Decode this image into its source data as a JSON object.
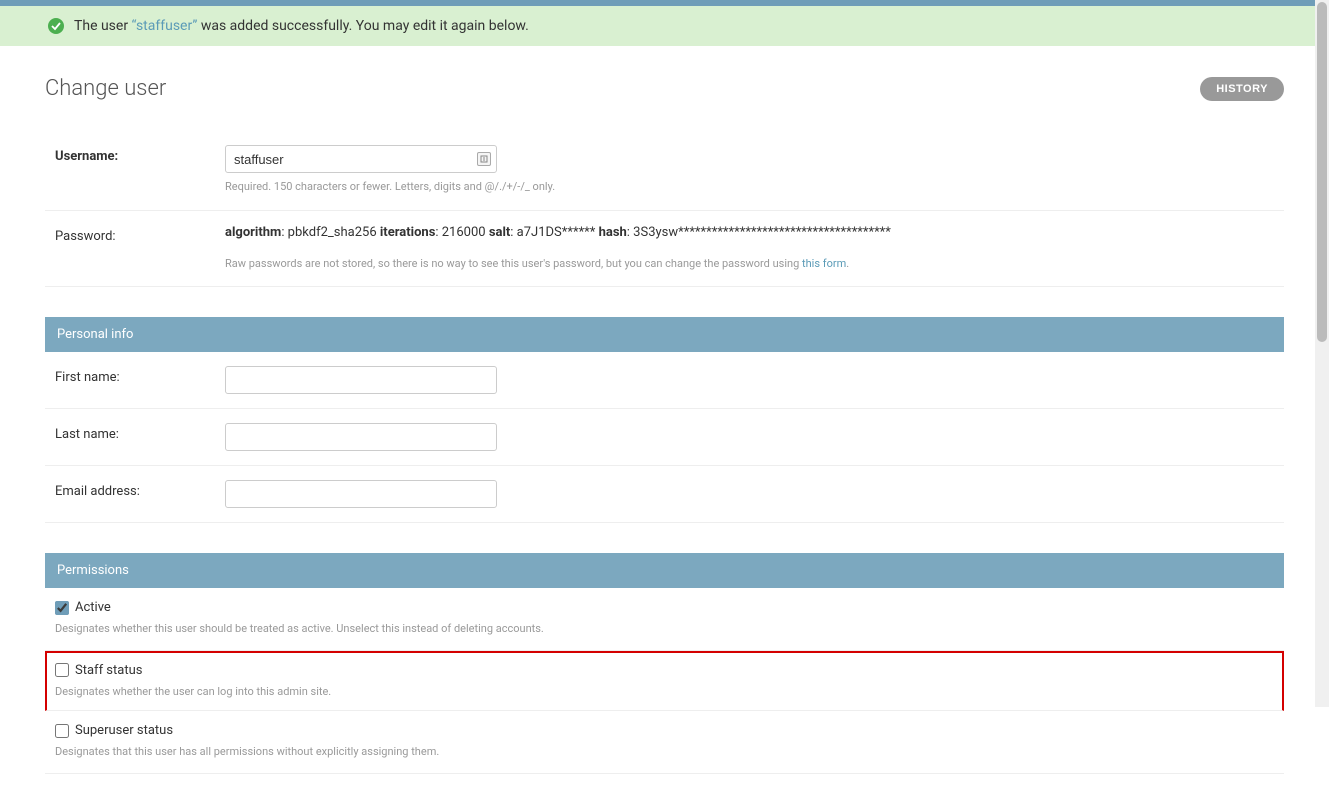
{
  "banner": {
    "prefix": "The user ",
    "quoted_open": "“",
    "user_link": "staffuser",
    "quoted_close": "”",
    "suffix": " was added successfully. You may edit it again below."
  },
  "page": {
    "title": "Change user",
    "history_button": "HISTORY"
  },
  "username": {
    "label": "Username:",
    "value": "staffuser",
    "help": "Required. 150 characters or fewer. Letters, digits and @/./+/-/_ only."
  },
  "password": {
    "label": "Password:",
    "algorithm_k": "algorithm",
    "algorithm_v": ": pbkdf2_sha256 ",
    "iterations_k": "iterations",
    "iterations_v": ": 216000 ",
    "salt_k": "salt",
    "salt_v": ": a7J1DS****** ",
    "hash_k": "hash",
    "hash_v": ": 3S3ysw**************************************",
    "help_prefix": "Raw passwords are not stored, so there is no way to see this user's password, but you can change the password using ",
    "help_link": "this form",
    "help_suffix": "."
  },
  "personal_info": {
    "header": "Personal info",
    "first_name_label": "First name:",
    "first_name_value": "",
    "last_name_label": "Last name:",
    "last_name_value": "",
    "email_label": "Email address:",
    "email_value": ""
  },
  "permissions": {
    "header": "Permissions",
    "active": {
      "label": "Active",
      "help": "Designates whether this user should be treated as active. Unselect this instead of deleting accounts.",
      "checked": true
    },
    "staff": {
      "label": "Staff status",
      "help": "Designates whether the user can log into this admin site.",
      "checked": false
    },
    "superuser": {
      "label": "Superuser status",
      "help": "Designates that this user has all permissions without explicitly assigning them.",
      "checked": false
    }
  }
}
